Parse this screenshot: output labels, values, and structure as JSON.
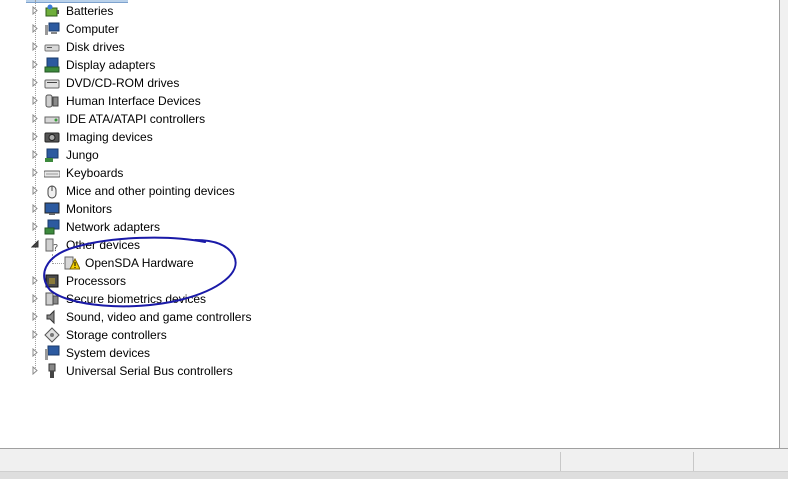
{
  "device_tree": {
    "categories": [
      {
        "label": "Batteries",
        "icon": "battery-icon",
        "expanded": false
      },
      {
        "label": "Computer",
        "icon": "computer-icon",
        "expanded": false
      },
      {
        "label": "Disk drives",
        "icon": "disk-drive-icon",
        "expanded": false
      },
      {
        "label": "Display adapters",
        "icon": "display-adapter-icon",
        "expanded": false
      },
      {
        "label": "DVD/CD-ROM drives",
        "icon": "dvd-drive-icon",
        "expanded": false
      },
      {
        "label": "Human Interface Devices",
        "icon": "hid-icon",
        "expanded": false
      },
      {
        "label": "IDE ATA/ATAPI controllers",
        "icon": "ide-controller-icon",
        "expanded": false
      },
      {
        "label": "Imaging devices",
        "icon": "camera-icon",
        "expanded": false
      },
      {
        "label": "Jungo",
        "icon": "jungo-icon",
        "expanded": false
      },
      {
        "label": "Keyboards",
        "icon": "keyboard-icon",
        "expanded": false
      },
      {
        "label": "Mice and other pointing devices",
        "icon": "mouse-icon",
        "expanded": false
      },
      {
        "label": "Monitors",
        "icon": "monitor-icon",
        "expanded": false
      },
      {
        "label": "Network adapters",
        "icon": "network-adapter-icon",
        "expanded": false
      },
      {
        "label": "Other devices",
        "icon": "unknown-device-icon",
        "expanded": true,
        "children": [
          {
            "label": "OpenSDA Hardware",
            "icon": "warning-device-icon"
          }
        ]
      },
      {
        "label": "Processors",
        "icon": "processor-icon",
        "expanded": false
      },
      {
        "label": "Secure biometrics devices",
        "icon": "biometric-icon",
        "expanded": false
      },
      {
        "label": "Sound, video and game controllers",
        "icon": "speaker-icon",
        "expanded": false
      },
      {
        "label": "Storage controllers",
        "icon": "storage-controller-icon",
        "expanded": false
      },
      {
        "label": "System devices",
        "icon": "system-device-icon",
        "expanded": false
      },
      {
        "label": "Universal Serial Bus controllers",
        "icon": "usb-icon",
        "expanded": false
      }
    ]
  },
  "annotation": {
    "shape": "hand-drawn-ellipse",
    "color": "#1a1aa8"
  }
}
